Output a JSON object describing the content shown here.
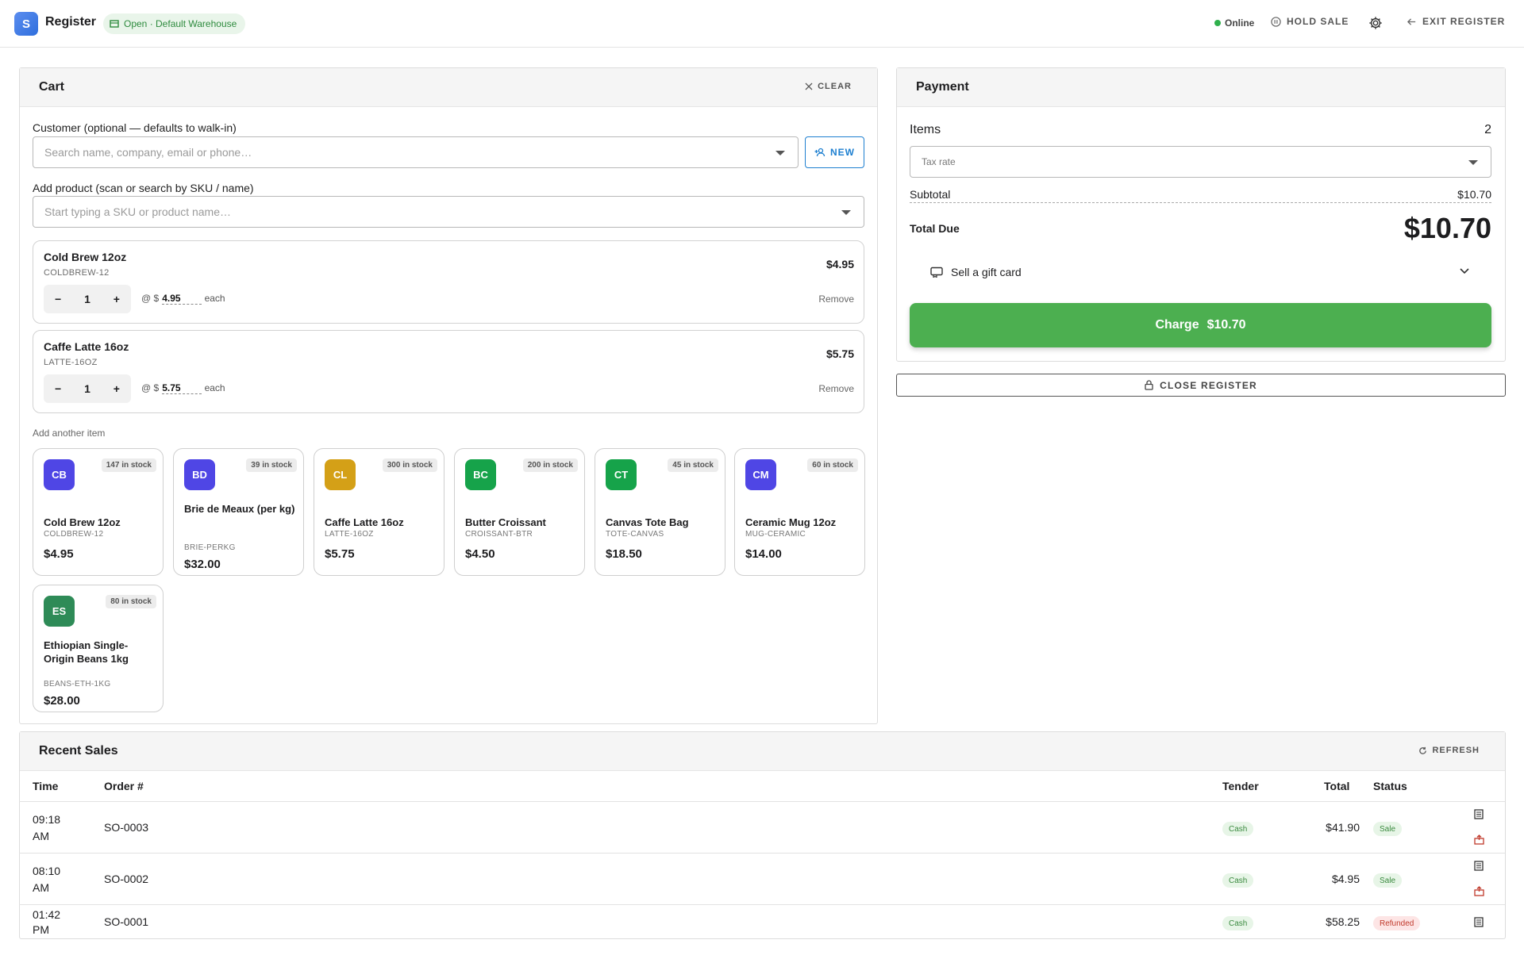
{
  "topbar": {
    "logo_letter": "S",
    "title": "Register",
    "warehouse_chip": "Open · Default Warehouse",
    "status": "Online",
    "hold_sale": "HOLD SALE",
    "exit_register": "EXIT REGISTER"
  },
  "cart": {
    "title": "Cart",
    "clear_label": "CLEAR",
    "customer_label": "Customer (optional — defaults to walk-in)",
    "customer_placeholder": "Search name, company, email or phone…",
    "new_label": "NEW",
    "product_label": "Add product (scan or search by SKU / name)",
    "product_placeholder": "Start typing a SKU or product name…",
    "items": [
      {
        "name": "Cold Brew 12oz",
        "sku": "COLDBREW-12",
        "line_total": "$4.95",
        "qty": "1",
        "unit_price": "4.95",
        "remove": "Remove"
      },
      {
        "name": "Caffe Latte 16oz",
        "sku": "LATTE-16OZ",
        "line_total": "$5.75",
        "qty": "1",
        "unit_price": "5.75",
        "remove": "Remove"
      }
    ],
    "at_symbol": "@ $",
    "each": "each",
    "add_another_label": "Add another item",
    "products": [
      {
        "initials": "CB",
        "color": "#4f46e5",
        "stock": "147 in stock",
        "name": "Cold Brew 12oz",
        "sku": "COLDBREW-12",
        "price": "$4.95"
      },
      {
        "initials": "BD",
        "color": "#4f46e5",
        "stock": "39 in stock",
        "name": "Brie de Meaux (per kg)",
        "sku": "BRIE-PERKG",
        "price": "$32.00"
      },
      {
        "initials": "CL",
        "color": "#d4a017",
        "stock": "300 in stock",
        "name": "Caffe Latte 16oz",
        "sku": "LATTE-16OZ",
        "price": "$5.75"
      },
      {
        "initials": "BC",
        "color": "#16a34a",
        "stock": "200 in stock",
        "name": "Butter Croissant",
        "sku": "CROISSANT-BTR",
        "price": "$4.50"
      },
      {
        "initials": "CT",
        "color": "#16a34a",
        "stock": "45 in stock",
        "name": "Canvas Tote Bag",
        "sku": "TOTE-CANVAS",
        "price": "$18.50"
      },
      {
        "initials": "CM",
        "color": "#4f46e5",
        "stock": "60 in stock",
        "name": "Ceramic Mug 12oz",
        "sku": "MUG-CERAMIC",
        "price": "$14.00"
      },
      {
        "initials": "ES",
        "color": "#2e8b57",
        "stock": "80 in stock",
        "name": "Ethiopian Single-Origin Beans 1kg",
        "sku": "BEANS-ETH-1KG",
        "price": "$28.00"
      }
    ]
  },
  "payment": {
    "title": "Payment",
    "items_label": "Items",
    "items_count": "2",
    "tax_placeholder": "Tax rate",
    "subtotal_label": "Subtotal",
    "subtotal_value": "$10.70",
    "total_label": "Total Due",
    "total_value": "$10.70",
    "gift_card_label": "Sell a gift card",
    "charge_label": "Charge",
    "charge_amount": "$10.70",
    "close_register": "CLOSE REGISTER"
  },
  "recent_sales": {
    "title": "Recent Sales",
    "refresh": "REFRESH",
    "columns": {
      "time": "Time",
      "order": "Order #",
      "tender": "Tender",
      "total": "Total",
      "status": "Status"
    },
    "rows": [
      {
        "time": "09:18 AM",
        "order": "SO-0003",
        "tender": "Cash",
        "total": "$41.90",
        "status": "Sale"
      },
      {
        "time": "08:10 AM",
        "order": "SO-0002",
        "tender": "Cash",
        "total": "$4.95",
        "status": "Sale"
      },
      {
        "time": "01:42 PM",
        "order": "SO-0001",
        "tender": "Cash",
        "total": "$58.25",
        "status": "Refunded"
      }
    ]
  }
}
